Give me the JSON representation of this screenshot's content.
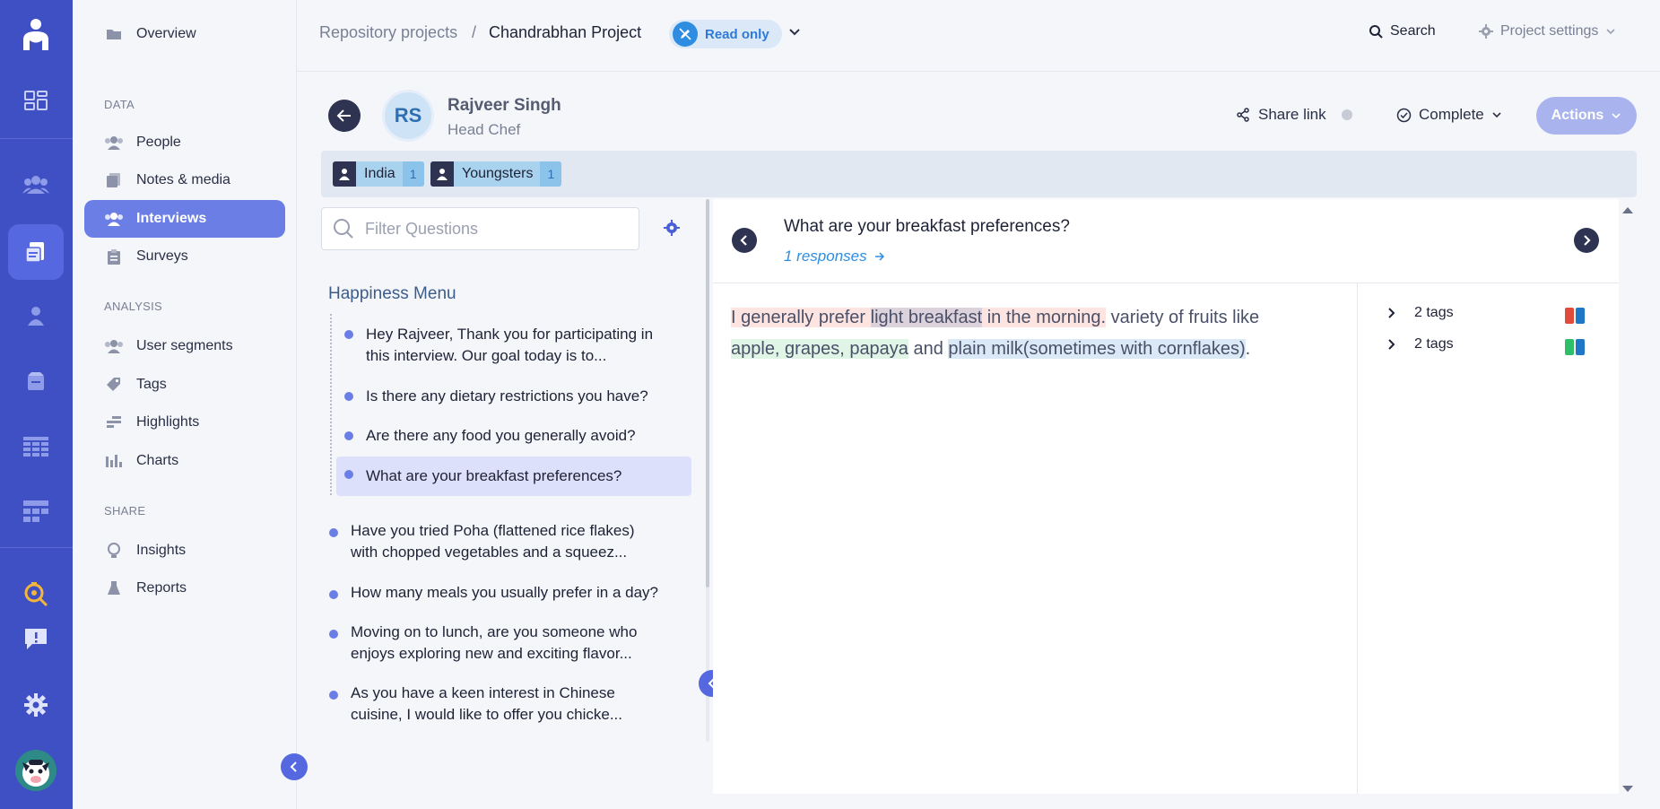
{
  "rail": {
    "icons": [
      "logo-icon",
      "dashboard-icon",
      "people-icon",
      "interviews-icon",
      "user-icon",
      "insights-icon",
      "table-icon",
      "grid-icon",
      "search-analyze-icon",
      "feedback-icon",
      "settings-icon"
    ],
    "accent": "#3f4fc4"
  },
  "nav": {
    "overview": "Overview",
    "section_data": "DATA",
    "people": "People",
    "notes": "Notes & media",
    "interviews": "Interviews",
    "surveys": "Surveys",
    "section_analysis": "ANALYSIS",
    "user_segments": "User segments",
    "tags": "Tags",
    "highlights": "Highlights",
    "charts": "Charts",
    "section_share": "SHARE",
    "insights": "Insights",
    "reports": "Reports"
  },
  "header": {
    "breadcrumb_root": "Repository projects",
    "breadcrumb_sep": "/",
    "breadcrumb_current": "Chandrabhan Project",
    "read_only": "Read only",
    "search": "Search",
    "project_settings": "Project settings"
  },
  "profile": {
    "initials": "RS",
    "name": "Rajveer Singh",
    "role": "Head Chef",
    "share_link": "Share link",
    "complete": "Complete",
    "actions": "Actions"
  },
  "segments": [
    {
      "label": "India",
      "count": "1"
    },
    {
      "label": "Youngsters",
      "count": "1"
    }
  ],
  "questions": {
    "filter_placeholder": "Filter Questions",
    "group_title": "Happiness Menu",
    "grouped": [
      {
        "l1": "Hey Rajveer, Thank you for participating in",
        "l2": "this interview. Our goal today is to..."
      },
      {
        "l1": "Is there any dietary restrictions you have?"
      },
      {
        "l1": "Are there any food you generally avoid?"
      },
      {
        "l1": "What are your breakfast preferences?"
      }
    ],
    "rest": [
      {
        "l1": "Have you tried Poha (flattened rice flakes)",
        "l2": "with chopped vegetables and a squeez..."
      },
      {
        "l1": "How many meals you usually prefer in a day?"
      },
      {
        "l1": "Moving on to lunch, are you someone who",
        "l2": "enjoys exploring new and exciting flavor..."
      },
      {
        "l1": "As you have a keen interest in Chinese",
        "l2": "cuisine, I would like to offer you chicke..."
      }
    ]
  },
  "response": {
    "question": "What are your breakfast preferences?",
    "responses_link": "1 responses",
    "answer_parts": {
      "p1": "I generally prefer ",
      "p2": "light breakfast",
      "p3": " in the morning.",
      "p4": " variety of fruits like ",
      "p5": "apple, grapes, papaya",
      "p6": " and ",
      "p7": "plain milk(sometimes with cornflakes)",
      "p8": "."
    },
    "tag_rows": [
      {
        "label": "2 tags",
        "colors": [
          "#e04b3c",
          "#1f77c8"
        ]
      },
      {
        "label": "2 tags",
        "colors": [
          "#2dbf6a",
          "#1f77c8"
        ]
      }
    ]
  }
}
